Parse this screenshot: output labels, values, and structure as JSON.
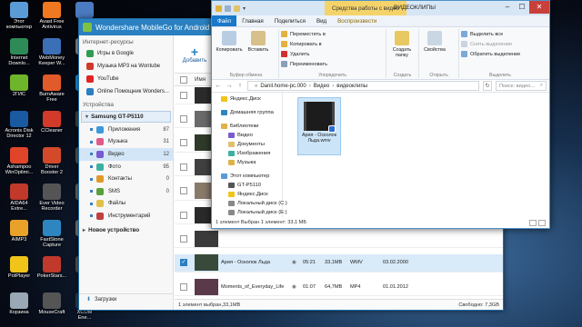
{
  "desktop": {
    "icons": [
      {
        "label": "Этот\nкомпьютер",
        "color": "#5b9bd5"
      },
      {
        "label": "Avast Free\nAntivirus",
        "color": "#f07820"
      },
      {
        "label": "Uni",
        "color": "#4a7bc0"
      },
      {
        "label": "Internet\nDownlo...",
        "color": "#2e8b57"
      },
      {
        "label": "WebMoney\nKeeper W...",
        "color": "#3b6fb6"
      },
      {
        "label": "Dow",
        "color": "#888888"
      },
      {
        "label": "2ГИС",
        "color": "#6fb52c"
      },
      {
        "label": "BurnAware\nFree",
        "color": "#e05a2a"
      },
      {
        "label": "Tea",
        "color": "#1f8ad0"
      },
      {
        "label": "Acronis Disk\nDirector 12",
        "color": "#1a5aa0"
      },
      {
        "label": "CCleaner",
        "color": "#d23a2a"
      },
      {
        "label": "Fo",
        "color": "#444444"
      },
      {
        "label": "Ashampoo\nWinOptimi...",
        "color": "#e0452a"
      },
      {
        "label": "Driver\nBooster 2",
        "color": "#d24a2a"
      },
      {
        "label": "Ha",
        "color": "#555555"
      },
      {
        "label": "AIDA64\nExtre...",
        "color": "#c0392b"
      },
      {
        "label": "Ever Video\nRecorder",
        "color": "#555555"
      },
      {
        "label": "Fo",
        "color": "#666666"
      },
      {
        "label": "AIMP3",
        "color": "#e9a12a"
      },
      {
        "label": "FastStone\nCapture",
        "color": "#2e86c1"
      },
      {
        "label": "I",
        "color": "#777777"
      },
      {
        "label": "PotPlayer",
        "color": "#f0c419"
      },
      {
        "label": "PokerStars...",
        "color": "#c0392b"
      },
      {
        "label": "A",
        "color": "#555555"
      },
      {
        "label": "Корзина",
        "color": "#9aa8b5"
      },
      {
        "label": "MouseCraft",
        "color": "#555555"
      },
      {
        "label": "XCOM\nEne...",
        "color": "#2c3e50"
      },
      {
        "label": "WOTping.exe",
        "color": "#7a7a7a"
      },
      {
        "label": "Battle vs\nChess ...",
        "color": "#7d5a3a"
      }
    ]
  },
  "mobilego": {
    "title": "Wondershare MobileGo for Android",
    "internet_section": "Интернет-ресурсы",
    "internet_items": [
      {
        "label": "Игры в Google",
        "color": "#2e9d52"
      },
      {
        "label": "Музыка MP3 на Wontube",
        "color": "#d03a2a"
      },
      {
        "label": "YouTube",
        "color": "#e02424"
      },
      {
        "label": "Online Помощник Wonders...",
        "color": "#2a80c0"
      }
    ],
    "devices_section": "Устройства",
    "device_name": "Samsung GT-P5110",
    "categories": [
      {
        "label": "Приложения",
        "count": "87",
        "color": "#3a9ad9"
      },
      {
        "label": "Музыка",
        "count": "31",
        "color": "#e05a8a"
      },
      {
        "label": "Видео",
        "count": "12",
        "color": "#7a5ad0",
        "selected": true
      },
      {
        "label": "Фото",
        "count": "95",
        "color": "#3ab0a0"
      },
      {
        "label": "Контакты",
        "count": "0",
        "color": "#e09a2a"
      },
      {
        "label": "SMS",
        "count": "0",
        "color": "#5aa03a"
      },
      {
        "label": "Файлы",
        "count": "",
        "color": "#e0c04a"
      },
      {
        "label": "Инструментарий",
        "count": "",
        "color": "#c04040"
      }
    ],
    "new_device": "Новое устройство",
    "downloads": "Загрузки",
    "toolbar": {
      "add_label": "Добавить"
    },
    "column_name": "Имя",
    "rows": [
      {
        "name": "",
        "duration": "",
        "size": "",
        "format": "",
        "date": "",
        "checked": false,
        "thumb": "#2b2b2b"
      },
      {
        "name": "",
        "duration": "",
        "size": "",
        "format": "",
        "date": "",
        "checked": false,
        "thumb": "#6a6a6a"
      },
      {
        "name": "",
        "duration": "",
        "size": "",
        "format": "",
        "date": "",
        "checked": false,
        "thumb": "#2f3a2a"
      },
      {
        "name": "",
        "duration": "",
        "size": "",
        "format": "",
        "date": "",
        "checked": false,
        "thumb": "#404040"
      },
      {
        "name": "",
        "duration": "",
        "size": "",
        "format": "",
        "date": "",
        "checked": false,
        "thumb": "#8a7a6a"
      },
      {
        "name": "",
        "duration": "",
        "size": "",
        "format": "",
        "date": "",
        "checked": false,
        "thumb": "#2a2a2a"
      },
      {
        "name": "",
        "duration": "",
        "size": "",
        "format": "",
        "date": "",
        "checked": false,
        "thumb": "#3a3a3a"
      },
      {
        "name": "Ария - Осколок Льда",
        "duration": "05:21",
        "size": "33,1MB",
        "format": "WMV",
        "date": "03.02.2000",
        "checked": true,
        "thumb": "#3a4a3a"
      },
      {
        "name": "Moments_of_Everyday_Life",
        "duration": "01:07",
        "size": "64,7MB",
        "format": "MP4",
        "date": "01.01.2012",
        "checked": false,
        "thumb": "#5a3a4a"
      },
      {
        "name": "mobfilms.org Transformers Epoha ...",
        "duration": "00:21",
        "size": "3,3MB",
        "format": "3GP",
        "date": "06.10.2014",
        "checked": false,
        "thumb": "#1a6ad0"
      }
    ],
    "status_left": "1 элемент выбран,33,1MB",
    "status_right": "Свободно: 7,3GB"
  },
  "explorer": {
    "context_tab": "Средства работы с видео",
    "window_title": "ВИДЕОКЛИПЫ",
    "tabs": [
      "Файл",
      "Главная",
      "Поделиться",
      "Вид",
      "Воспроизвести"
    ],
    "ribbon": {
      "copy": "Копировать",
      "paste": "Вставить",
      "buffer_group": "Буфер обмена",
      "move_to": "Переместить в",
      "copy_to": "Копировать в",
      "delete": "Удалить",
      "rename": "Переименовать",
      "organize_group": "Упорядочить",
      "new_folder": "Создать\nпапку",
      "create_group": "Создать",
      "properties": "Свойства",
      "open_group": "Открыть",
      "select_all": "Выделить все",
      "remove_selection": "Снять выделение",
      "invert_selection": "Обратить выделение",
      "select_group": "Выделить"
    },
    "path": [
      "Danil.home-pc.000",
      "Видео",
      "видеоклипы"
    ],
    "search_placeholder": "Поиск: видео...",
    "tree": [
      {
        "label": "Яндекс.Диск",
        "indent": 0,
        "color": "#f0c419"
      },
      {
        "label": "Домашняя группа",
        "indent": 0,
        "color": "#2e86c1"
      },
      {
        "label": "Библиотеки",
        "indent": 0,
        "color": "#e0b24a"
      },
      {
        "label": "Видео",
        "indent": 1,
        "color": "#7a5ad0"
      },
      {
        "label": "Документы",
        "indent": 1,
        "color": "#e0c06a"
      },
      {
        "label": "Изображения",
        "indent": 1,
        "color": "#3ab0a0"
      },
      {
        "label": "Музыка",
        "indent": 1,
        "color": "#e0b24a"
      },
      {
        "label": "Этот компьютер",
        "indent": 0,
        "color": "#5b9bd5"
      },
      {
        "label": "GT-P5110",
        "indent": 1,
        "color": "#555555"
      },
      {
        "label": "Яндекс.Диск",
        "indent": 1,
        "color": "#f0c419"
      },
      {
        "label": "Локальный диск (C:)",
        "indent": 1,
        "color": "#888888"
      },
      {
        "label": "Локальный диск (E:)",
        "indent": 1,
        "color": "#888888"
      }
    ],
    "file_name": "Ария - Осколок Льда.wmv",
    "status": "1 элемент   Выбран 1 элемент: 33,1 МБ"
  }
}
